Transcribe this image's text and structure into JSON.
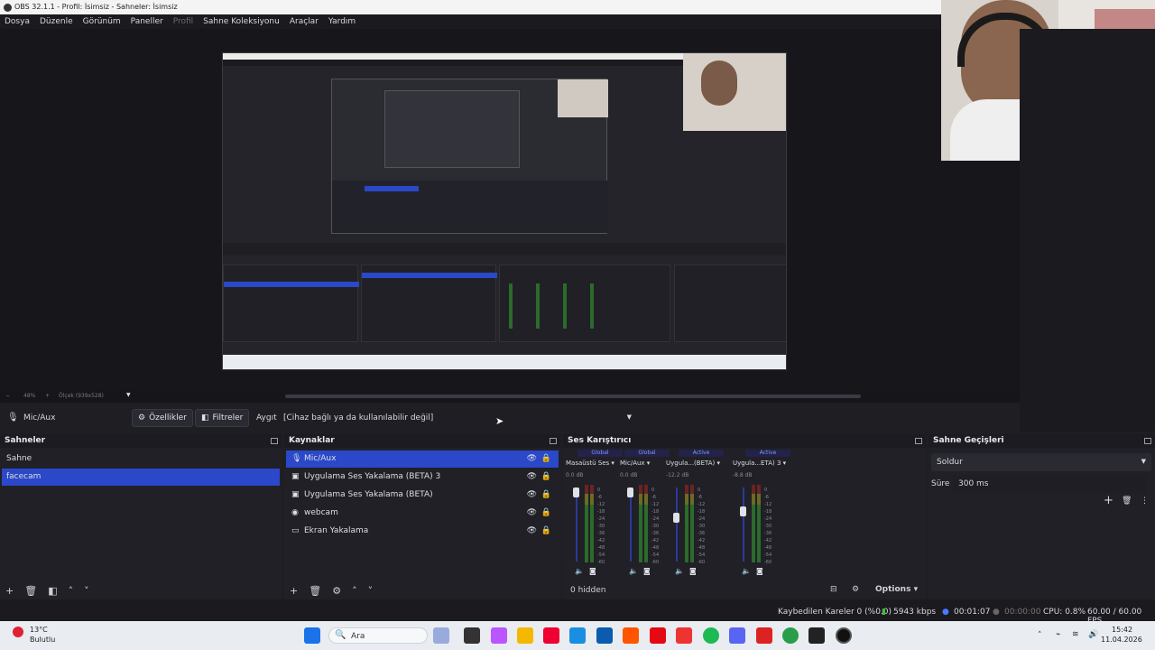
{
  "window": {
    "title": "OBS 32.1.1 - Profil: İsimsiz - Sahneler: İsimsiz"
  },
  "menu": [
    {
      "label": "Dosya"
    },
    {
      "label": "Düzenle"
    },
    {
      "label": "Görünüm"
    },
    {
      "label": "Paneller"
    },
    {
      "label": "Profil",
      "disabled": true
    },
    {
      "label": "Sahne Koleksiyonu"
    },
    {
      "label": "Araçlar"
    },
    {
      "label": "Yardım"
    }
  ],
  "preview": {
    "zoom": "48%",
    "scale": "Ölçek (939x528)"
  },
  "properties_bar": {
    "source_name": "Mic/Aux",
    "properties_label": "Özellikler",
    "filters_label": "Filtreler",
    "device_label": "Aygıt",
    "device_value": "[Cihaz bağlı ya da kullanılabilir değil]"
  },
  "scenes": {
    "title": "Sahneler",
    "items": [
      {
        "label": "Sahne"
      },
      {
        "label": "facecam",
        "selected": true
      }
    ]
  },
  "sources": {
    "title": "Kaynaklar",
    "items": [
      {
        "label": "Mic/Aux",
        "icon": "mic-icon",
        "selected": true
      },
      {
        "label": "Uygulama Ses Yakalama (BETA) 3",
        "icon": "window-icon"
      },
      {
        "label": "Uygulama Ses Yakalama (BETA)",
        "icon": "window-icon"
      },
      {
        "label": "webcam",
        "icon": "camera-icon"
      },
      {
        "label": "Ekran Yakalama",
        "icon": "monitor-icon"
      }
    ]
  },
  "mixer": {
    "title": "Ses Karıştırıcı",
    "hidden": "0 hidden",
    "options": "Options",
    "channels": [
      {
        "tag": "Global",
        "name": "Masaüstü Ses",
        "db": "0.0 dB",
        "level": 1.0
      },
      {
        "tag": "Global",
        "name": "Mic/Aux",
        "db": "0.0 dB",
        "level": 1.0
      },
      {
        "tag": "Active",
        "name": "Uygula...(BETA)",
        "db": "-12.2 dB",
        "level": 0.6
      },
      {
        "tag": "Active",
        "name": "Uygula...ETA) 3",
        "db": "-8.8 dB",
        "level": 0.7
      }
    ],
    "ticks": [
      "0",
      "-6",
      "-12",
      "-18",
      "-24",
      "-30",
      "-36",
      "-42",
      "-48",
      "-54",
      "-60"
    ]
  },
  "transitions": {
    "title": "Sahne Geçişleri",
    "type": "Soldur",
    "duration_label": "Süre",
    "duration_value": "300 ms"
  },
  "status": {
    "dropped": "Kaybedilen Kareler 0 (%0.0)",
    "bitrate": "5943 kbps",
    "rec_time": "00:01:07",
    "stream_time": "00:00:00",
    "cpu": "CPU: 0.8%",
    "fps": "60.00 / 60.00 FPS"
  },
  "taskbar": {
    "weather_temp": "13°C",
    "weather_desc": "Bulutlu",
    "search": "Ara",
    "time": "15:42",
    "date": "11.04.2026"
  },
  "colors": {
    "accent": "#2a48c8",
    "panel": "#202026",
    "bg": "#1e1e23"
  }
}
